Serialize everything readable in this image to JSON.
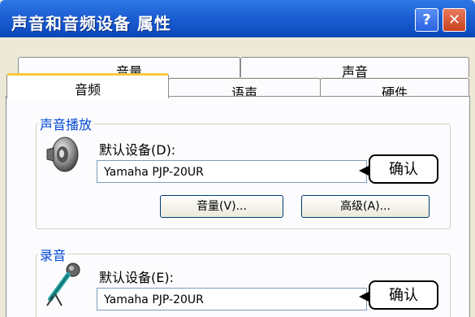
{
  "window": {
    "title": "声音和音频设备 属性",
    "help_glyph": "?",
    "close_glyph": "✕"
  },
  "tabs": {
    "row1": [
      "音量",
      "声音"
    ],
    "row2": [
      "音频",
      "语声",
      "硬件"
    ],
    "active": "音频"
  },
  "playback": {
    "group_title": "声音播放",
    "default_device_label": "默认设备(D):",
    "device_value": "Yamaha PJP-20UR",
    "volume_button": "音量(V)...",
    "advanced_button": "高级(A)..."
  },
  "recording": {
    "group_title": "录音",
    "default_device_label": "默认设备(E):",
    "device_value": "Yamaha PJP-20UR"
  },
  "annotations": {
    "confirm_1": "确认",
    "confirm_2": "确认"
  },
  "icons": {
    "speaker": "speaker-icon",
    "microphone": "microphone-icon"
  },
  "colors": {
    "titlebar": "#1c5fd3",
    "group_title": "#0046d5",
    "active_tab_accent": "#ffc83c",
    "close_button": "#c9421f"
  }
}
